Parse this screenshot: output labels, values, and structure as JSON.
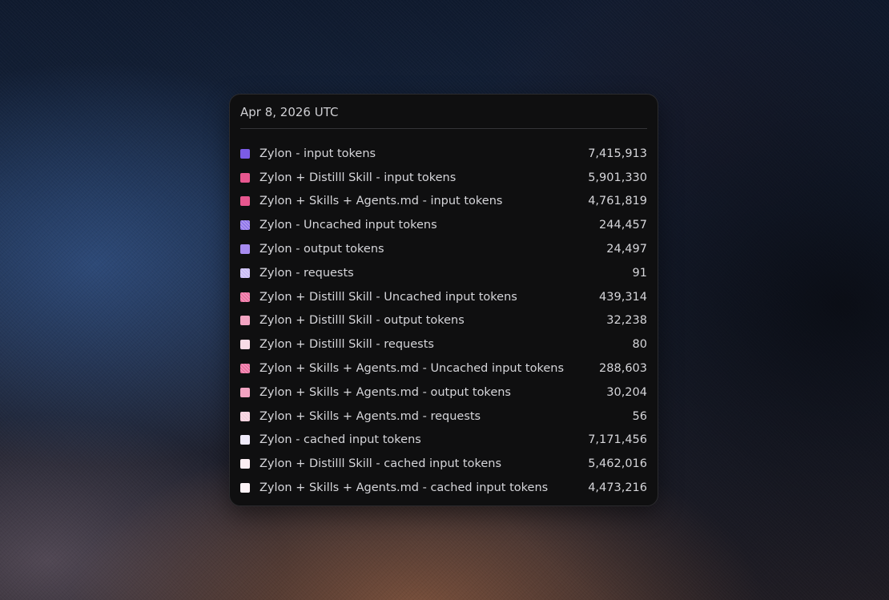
{
  "tooltip": {
    "date": "Apr 8, 2026 UTC",
    "rows": [
      {
        "label": "Zylon - input tokens",
        "value": "7,415,913",
        "color": "#7b5ce6",
        "hatched": false
      },
      {
        "label": "Zylon + Distilll Skill - input tokens",
        "value": "5,901,330",
        "color": "#e8578f",
        "hatched": false
      },
      {
        "label": "Zylon + Skills + Agents.md - input tokens",
        "value": "4,761,819",
        "color": "#e8578f",
        "hatched": false
      },
      {
        "label": "Zylon - Uncached input tokens",
        "value": "244,457",
        "color": "#8f74ea",
        "hatched": true
      },
      {
        "label": "Zylon - output tokens",
        "value": "24,497",
        "color": "#a78bf0",
        "hatched": false
      },
      {
        "label": "Zylon - requests",
        "value": "91",
        "color": "#c9bcf5",
        "hatched": true
      },
      {
        "label": "Zylon + Distilll Skill - Uncached input tokens",
        "value": "439,314",
        "color": "#ec6fa0",
        "hatched": true
      },
      {
        "label": "Zylon + Distilll Skill - output tokens",
        "value": "32,238",
        "color": "#f2a4c2",
        "hatched": false
      },
      {
        "label": "Zylon + Distilll Skill - requests",
        "value": "80",
        "color": "#f8dbe6",
        "hatched": false
      },
      {
        "label": "Zylon + Skills + Agents.md - Uncached input tokens",
        "value": "288,603",
        "color": "#ec6fa0",
        "hatched": true
      },
      {
        "label": "Zylon + Skills + Agents.md - output tokens",
        "value": "30,204",
        "color": "#f2a4c2",
        "hatched": false
      },
      {
        "label": "Zylon + Skills + Agents.md - requests",
        "value": "56",
        "color": "#f6cfdd",
        "hatched": true
      },
      {
        "label": "Zylon - cached input tokens",
        "value": "7,171,456",
        "color": "#efeaf9",
        "hatched": false
      },
      {
        "label": "Zylon + Distilll Skill - cached input tokens",
        "value": "5,462,016",
        "color": "#fbeef3",
        "hatched": false
      },
      {
        "label": "Zylon + Skills + Agents.md - cached input tokens",
        "value": "4,473,216",
        "color": "#fcf2f6",
        "hatched": false
      }
    ]
  }
}
